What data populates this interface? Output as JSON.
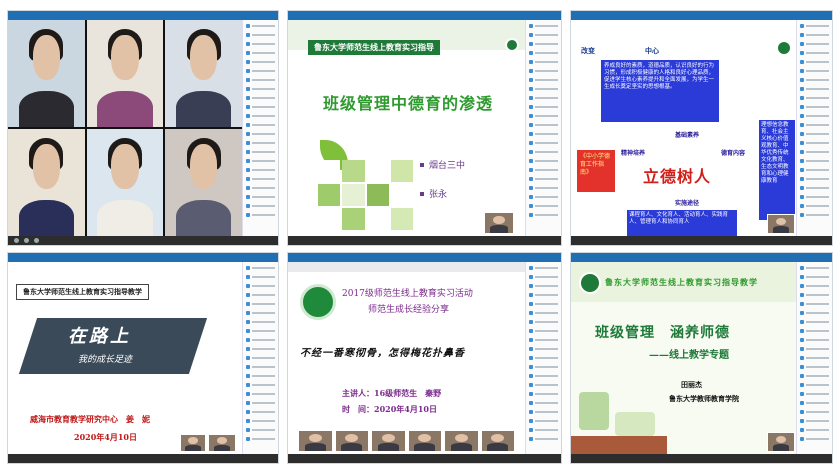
{
  "panels": [
    {
      "title": "",
      "kind": "video-grid"
    },
    {
      "title": "",
      "kind": "slide",
      "banner": "鲁东大学师范生线上教育实习指导",
      "heading": "班级管理中德育的渗透",
      "list": [
        "烟台三中",
        "张永"
      ]
    },
    {
      "title": "",
      "kind": "slide",
      "top_labels": [
        "改变",
        "",
        "中心"
      ],
      "box_top": "养成良好的素质，道德品质，认识良好的行为习惯，形成积极健康的人格和良好心理品质，促进学生核心素养提升和全面发展，为学生一生成长奠定坚实的思想根基。",
      "left_box": "《中小学德育工作指南》",
      "center_big": "立德树人",
      "arrow_labels": [
        "精神培养",
        "基础素养",
        "德育内容",
        "实施途径"
      ],
      "right_box": "理想信念教育、社会主义核心价值观教育、中华优秀传统文化教育、生态文明教育和心理健康教育",
      "bottom_box": "课程育人、文化育人、活动育人、实践育人、管理育人和协同育人"
    },
    {
      "title": "",
      "kind": "slide",
      "banner": "鲁东大学师范生线上教育实习指导教学",
      "main_text": "在路上",
      "sub_text": "我的成长足迹",
      "footer_org": "威海市教育教学研究中心　姜　妮",
      "footer_date": "2020年4月10日"
    },
    {
      "title": "",
      "kind": "slide",
      "title_line1": "2017级师范生线上教育实习活动",
      "title_line2": "师范生成长经验分享",
      "motto": "不经一番寒彻骨，怎得梅花扑鼻香",
      "speaker": "主讲人：16级师范生　秦野",
      "time": "时　间：2020年4月10日"
    },
    {
      "title": "",
      "kind": "slide",
      "banner": "鲁东大学师范生线上教育实习指导教学",
      "heading": "班级管理　涵养师德",
      "subheading": "——线上教学专题",
      "presenter": "田丽杰",
      "org": "鲁东大学教师教育学院"
    }
  ],
  "colors": {
    "titlebar": "#1f6fb2",
    "green_banner": "#1f7a3a",
    "slide_green_text": "#2f9a2f",
    "slide_purple": "#7b2a8c",
    "red_big": "#d0201a",
    "accent_blue": "#1a3c8c"
  },
  "icons": {
    "sidebar_dot": "user-icon",
    "logo": "university-logo-icon"
  }
}
